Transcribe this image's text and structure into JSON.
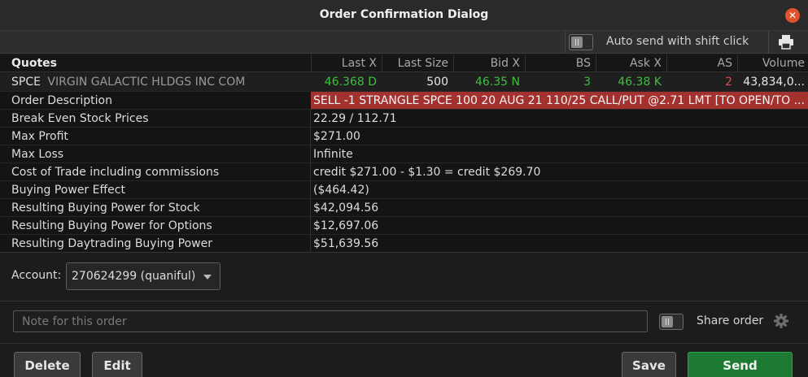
{
  "window": {
    "title": "Order Confirmation Dialog"
  },
  "toolbar": {
    "auto_send_label": "Auto send with shift click"
  },
  "quotes": {
    "headers": [
      "Quotes",
      "Last X",
      "Last Size",
      "Bid X",
      "BS",
      "Ask X",
      "AS",
      "Volume"
    ],
    "row": {
      "symbol": "SPCE",
      "description": "VIRGIN GALACTIC HLDGS INC COM",
      "last_x": "46.368 D",
      "last_size": "500",
      "bid_x": "46.35 N",
      "bs": "3",
      "ask_x": "46.38 K",
      "as": "2",
      "volume": "43,834,0..."
    }
  },
  "details": [
    {
      "label": "Order Description",
      "value": "SELL -1 STRANGLE SPCE 100 20 AUG 21 110/25 CALL/PUT @2.71 LMT [TO OPEN/TO ..."
    },
    {
      "label": "Break Even Stock Prices",
      "value": "22.29 / 112.71"
    },
    {
      "label": "Max Profit",
      "value": "$271.00"
    },
    {
      "label": "Max Loss",
      "value": "Infinite"
    },
    {
      "label": "Cost of Trade including commissions",
      "value": "credit $271.00 - $1.30 = credit $269.70"
    },
    {
      "label": "Buying Power Effect",
      "value": "($464.42)"
    },
    {
      "label": "Resulting Buying Power for Stock",
      "value": "$42,094.56"
    },
    {
      "label": "Resulting Buying Power for Options",
      "value": "$12,697.06"
    },
    {
      "label": "Resulting Daytrading Buying Power",
      "value": "$51,639.56"
    }
  ],
  "account": {
    "label": "Account:",
    "selected": "270624299 (quaniful)"
  },
  "note": {
    "placeholder": "Note for this order",
    "value": ""
  },
  "share": {
    "label": "Share order"
  },
  "buttons": {
    "delete": "Delete",
    "edit": "Edit",
    "save": "Save",
    "send": "Send"
  },
  "icons": {
    "close": "close-icon",
    "printer": "printer-icon",
    "gear": "gear-icon",
    "dropdown": "chevron-down-icon"
  },
  "colors": {
    "positive": "#3fbe3f",
    "negative": "#e54848",
    "order_highlight": "#a3322f",
    "send_button": "#1d7a32"
  }
}
